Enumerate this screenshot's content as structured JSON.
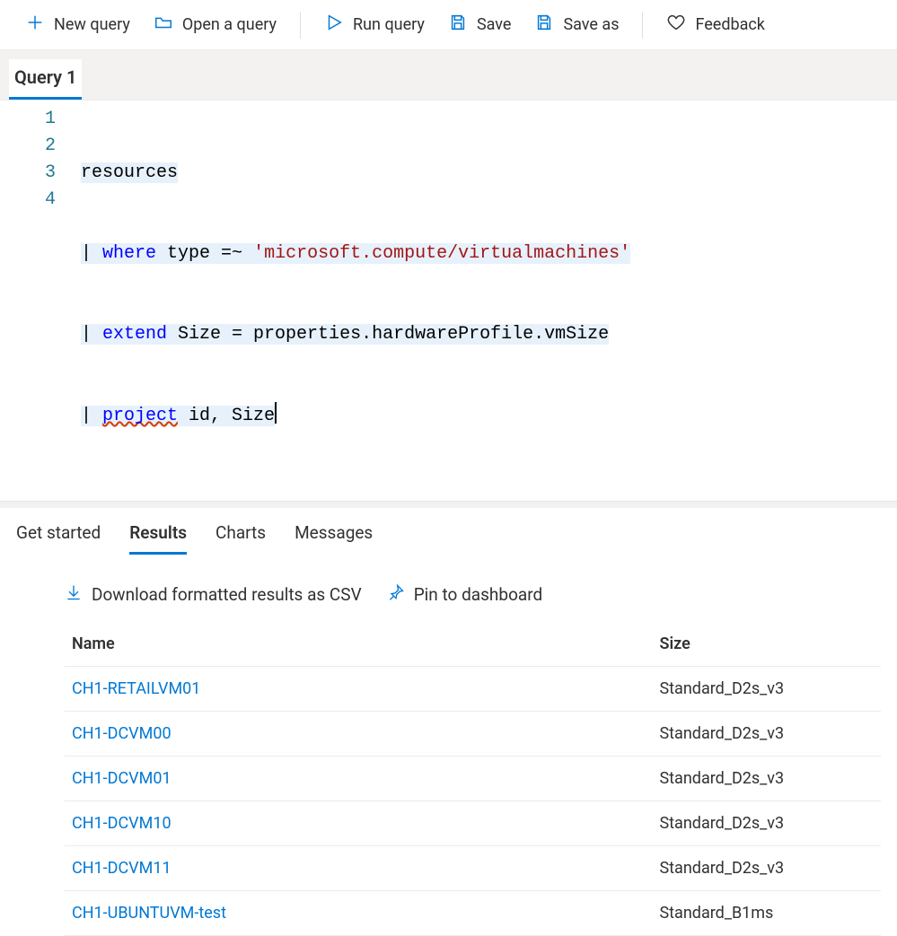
{
  "toolbar": {
    "new_query": "New query",
    "open_query": "Open a query",
    "run_query": "Run query",
    "save": "Save",
    "save_as": "Save as",
    "feedback": "Feedback"
  },
  "tabs": {
    "active": "Query 1"
  },
  "editor": {
    "lines": [
      "1",
      "2",
      "3",
      "4"
    ],
    "code": {
      "l1": "resources",
      "l2_pipe": "| ",
      "l2_where": "where",
      "l2_mid": " type =~ ",
      "l2_str": "'microsoft.compute/virtualmachines'",
      "l3_pipe": "| ",
      "l3_extend": "extend",
      "l3_rest": " Size = properties.hardwareProfile.vmSize",
      "l4_pipe": "| ",
      "l4_project": "project",
      "l4_rest": " id, Size"
    }
  },
  "results_tabs": {
    "get_started": "Get started",
    "results": "Results",
    "charts": "Charts",
    "messages": "Messages"
  },
  "actions": {
    "download_csv": "Download formatted results as CSV",
    "pin": "Pin to dashboard"
  },
  "table": {
    "headers": {
      "name": "Name",
      "size": "Size"
    },
    "rows": [
      {
        "name": "CH1-RETAILVM01",
        "size": "Standard_D2s_v3"
      },
      {
        "name": "CH1-DCVM00",
        "size": "Standard_D2s_v3"
      },
      {
        "name": "CH1-DCVM01",
        "size": "Standard_D2s_v3"
      },
      {
        "name": "CH1-DCVM10",
        "size": "Standard_D2s_v3"
      },
      {
        "name": "CH1-DCVM11",
        "size": "Standard_D2s_v3"
      },
      {
        "name": "CH1-UBUNTUVM-test",
        "size": "Standard_B1ms"
      }
    ]
  }
}
